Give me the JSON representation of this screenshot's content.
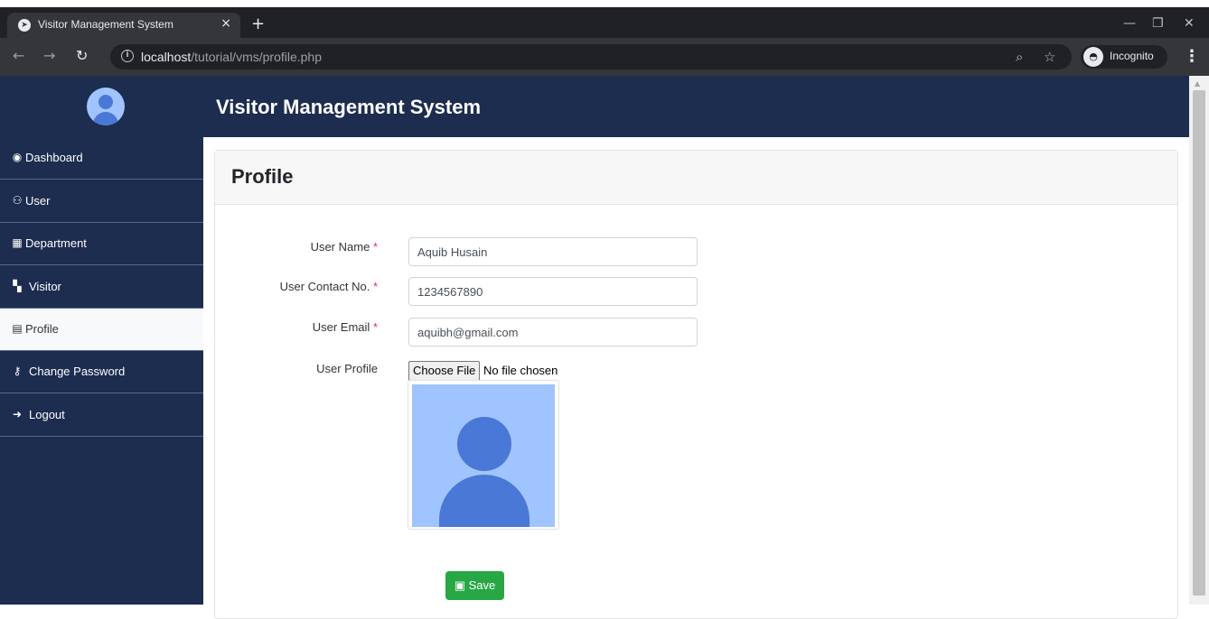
{
  "browser": {
    "tab_title": "Visitor Management System",
    "tab_close": "×",
    "new_tab": "+",
    "url_host": "localhost",
    "url_path": "/tutorial/vms/profile.php",
    "incognito_label": "Incognito",
    "window_controls": [
      "—",
      "❐",
      "✕"
    ]
  },
  "header": {
    "title": "Visitor Management System"
  },
  "sidebar": {
    "items": [
      {
        "label": "Dashboard",
        "icon": "dashboard-icon",
        "glyph": "◉"
      },
      {
        "label": "User",
        "icon": "users-icon",
        "glyph": "⚇"
      },
      {
        "label": "Department",
        "icon": "building-icon",
        "glyph": "▦"
      },
      {
        "label": "Visitor",
        "icon": "visitor-icon",
        "glyph": "▚"
      },
      {
        "label": "Profile",
        "icon": "id-badge-icon",
        "glyph": "▤"
      },
      {
        "label": "Change Password",
        "icon": "key-icon",
        "glyph": "⚷"
      },
      {
        "label": "Logout",
        "icon": "sign-out-icon",
        "glyph": "➜"
      }
    ],
    "active": "Profile"
  },
  "page": {
    "title": "Profile"
  },
  "form": {
    "user_name_label": "User Name",
    "user_name_value": "Aquib Husain",
    "contact_label": "User Contact No.",
    "contact_value": "1234567890",
    "email_label": "User Email",
    "email_value": "aquibh@gmail.com",
    "required_mark": "*",
    "profile_label": "User Profile",
    "file_button": "Choose File",
    "file_status": "No file chosen",
    "save_label": "Save"
  },
  "colors": {
    "nav_bg": "#1d2d50",
    "save_button": "#28a745",
    "required": "#dc3545"
  }
}
